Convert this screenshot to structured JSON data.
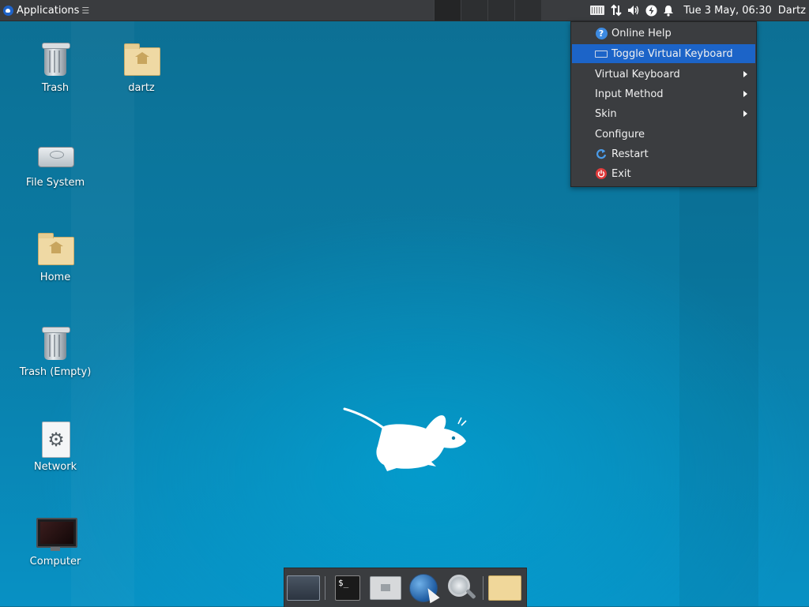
{
  "top_panel": {
    "applications_label": "Applications",
    "applications_suffix": "☰",
    "clock": "Tue  3 May, 06:30",
    "user": "Dartz"
  },
  "context_menu": {
    "items": [
      {
        "label": "Online Help",
        "icon": "help-icon",
        "selected": false,
        "submenu": false
      },
      {
        "label": "Toggle Virtual Keyboard",
        "icon": "keyboard-icon",
        "selected": true,
        "submenu": false
      },
      {
        "label": "Virtual Keyboard",
        "icon": null,
        "selected": false,
        "submenu": true
      },
      {
        "label": "Input Method",
        "icon": null,
        "selected": false,
        "submenu": true
      },
      {
        "label": "Skin",
        "icon": null,
        "selected": false,
        "submenu": true
      },
      {
        "label": "Configure",
        "icon": null,
        "selected": false,
        "submenu": false
      },
      {
        "label": "Restart",
        "icon": "restart-icon",
        "selected": false,
        "submenu": false
      },
      {
        "label": "Exit",
        "icon": "power-icon",
        "selected": false,
        "submenu": false
      }
    ]
  },
  "desktop": {
    "icons": [
      {
        "label": "Trash",
        "icon": "trash-icon"
      },
      {
        "label": "dartz",
        "icon": "home-folder-icon"
      },
      {
        "label": "File System",
        "icon": "hard-disk-icon"
      },
      {
        "label": "Home",
        "icon": "home-folder-icon"
      },
      {
        "label": "Trash (Empty)",
        "icon": "trash-icon"
      },
      {
        "label": "Network",
        "icon": "network-gear-icon"
      },
      {
        "label": "Computer",
        "icon": "monitor-icon"
      }
    ]
  },
  "dock": {
    "terminal_glyph": "$_",
    "items": [
      "show-desktop-icon",
      "terminal-icon",
      "home-folder-icon",
      "web-browser-icon",
      "search-icon",
      "file-manager-icon"
    ]
  },
  "colors": {
    "panel": "#3a3c3f",
    "menu_bg": "#3b3d40",
    "menu_selected": "#1c64c8",
    "desktop_blue": "#0a7aa3"
  }
}
